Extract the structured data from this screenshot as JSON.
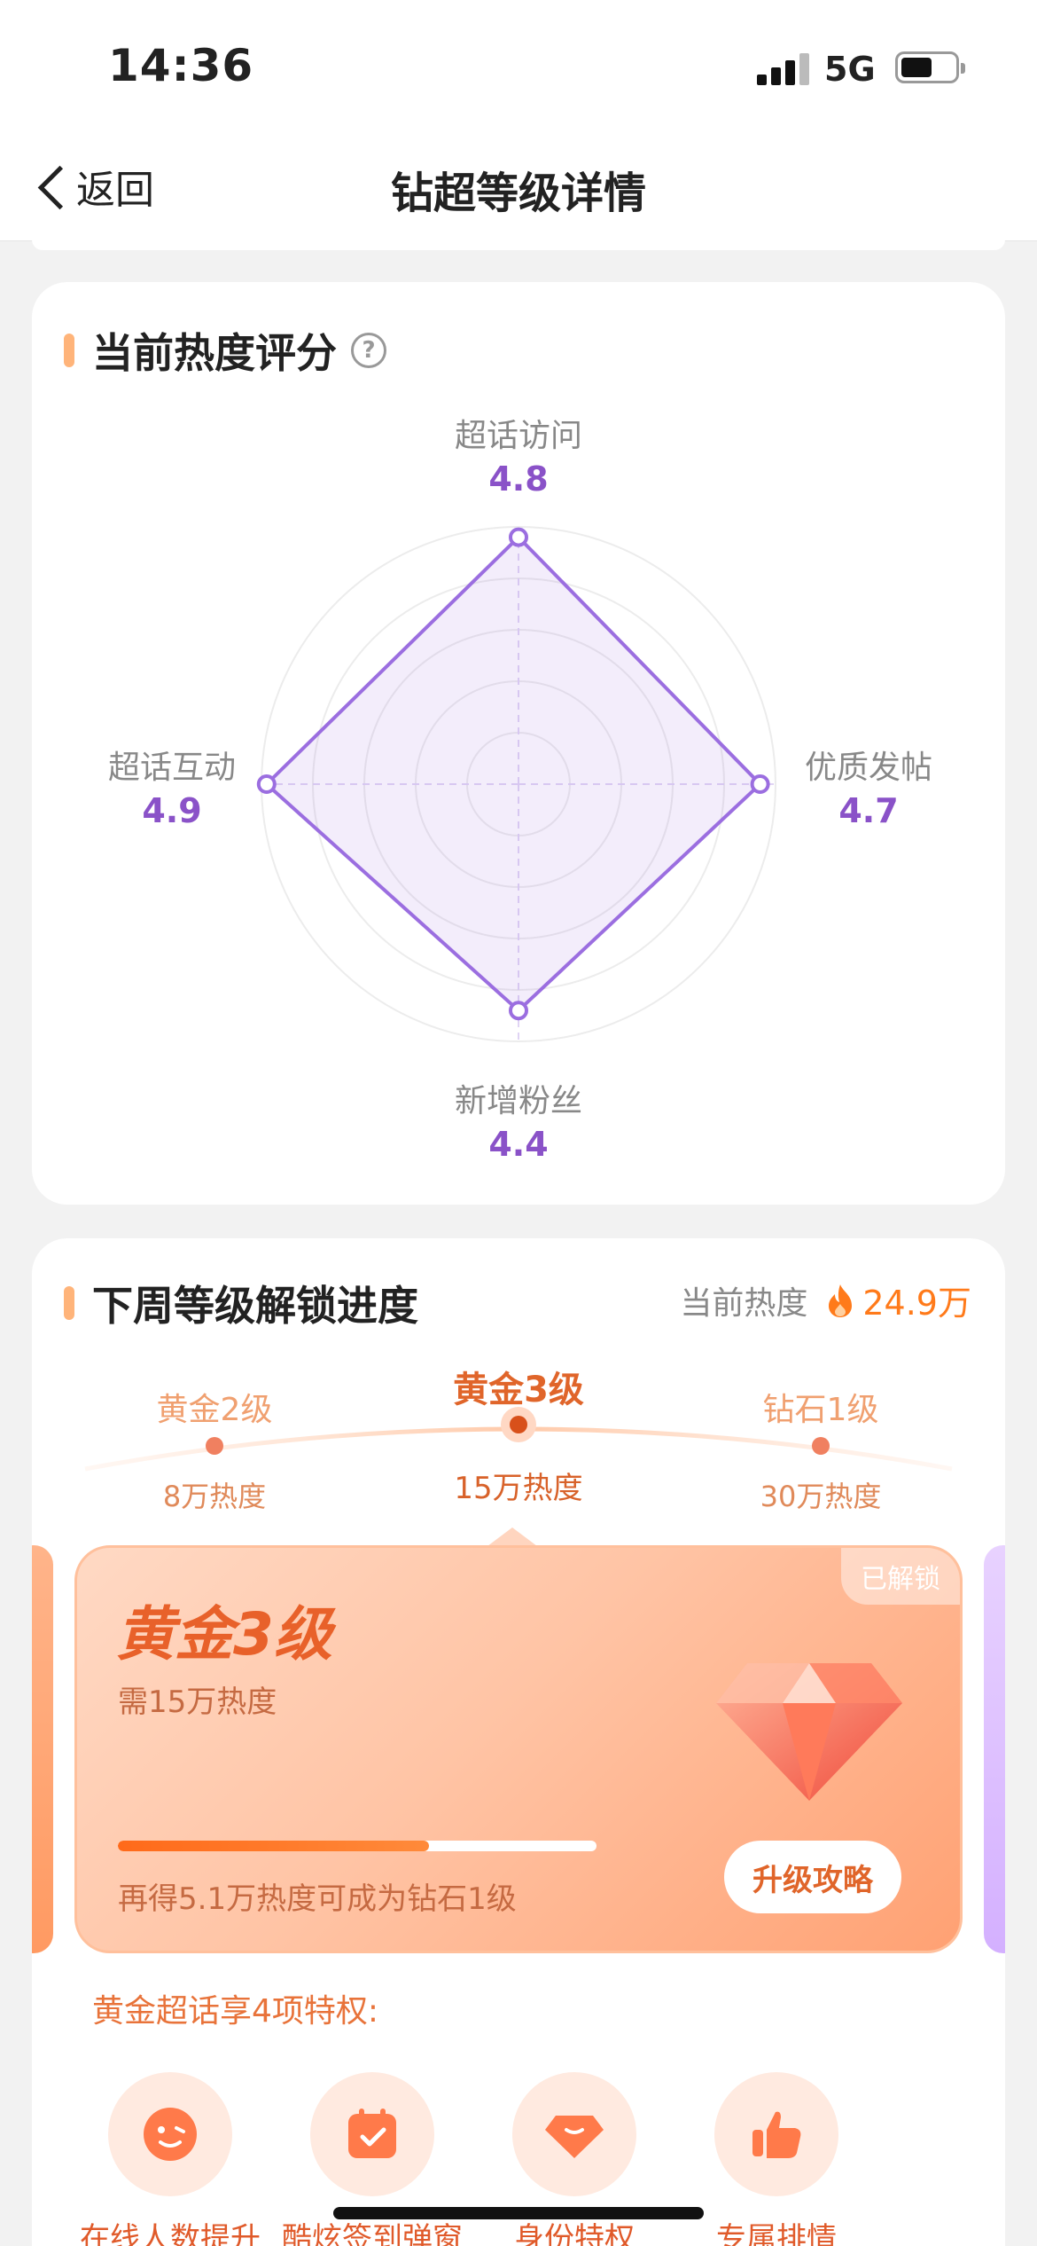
{
  "status_bar": {
    "time": "14:36",
    "network": "5G"
  },
  "nav": {
    "back_label": "返回",
    "title": "钻超等级详情"
  },
  "score_card": {
    "title": "当前热度评分",
    "help": "?",
    "axes": [
      {
        "label": "超话访问",
        "value": "4.8"
      },
      {
        "label": "优质发帖",
        "value": "4.7"
      },
      {
        "label": "新增粉丝",
        "value": "4.4"
      },
      {
        "label": "超话互动",
        "value": "4.9"
      }
    ]
  },
  "chart_data": {
    "type": "radar",
    "categories": [
      "超话访问",
      "优质发帖",
      "新增粉丝",
      "超话互动"
    ],
    "values": [
      4.8,
      4.7,
      4.4,
      4.9
    ],
    "range": [
      0,
      5
    ],
    "rings": 5,
    "color": "#9b6ee0"
  },
  "progress_card": {
    "title": "下周等级解锁进度",
    "current_heat_label": "当前热度",
    "current_heat_value": "24.9万",
    "levels": [
      {
        "name": "黄金2级",
        "heat": "8万热度"
      },
      {
        "name": "黄金3级",
        "heat": "15万热度"
      },
      {
        "name": "钻石1级",
        "heat": "30万热度"
      }
    ],
    "level_card": {
      "badge": "已解锁",
      "title": "黄金3级",
      "requirement": "需15万热度",
      "progress_fraction": 0.65,
      "tip": "再得5.1万热度可成为钻石1级",
      "button": "升级攻略"
    },
    "privileges_title": "黄金超话享4项特权:",
    "privileges": [
      {
        "label": "在线人数提升",
        "icon": "face-icon"
      },
      {
        "label": "酷炫签到弹窗",
        "icon": "calendar-check-icon"
      },
      {
        "label": "身份特权",
        "icon": "gem-badge-icon"
      },
      {
        "label": "专属排情",
        "icon": "thumbs-up-icon"
      }
    ]
  },
  "colors": {
    "accent_orange": "#ff7a1a",
    "radar_purple": "#9b6ee0"
  }
}
